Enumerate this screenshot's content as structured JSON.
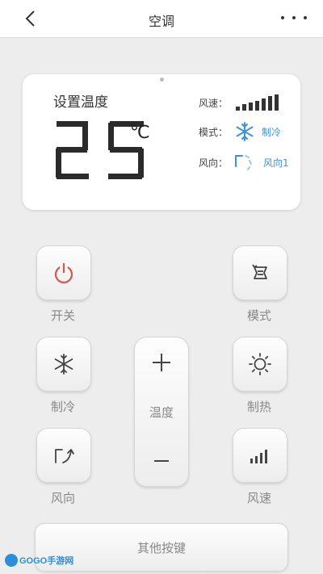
{
  "header": {
    "title": "空调"
  },
  "panel": {
    "set_temp_label": "设置温度",
    "temperature": "25",
    "unit": "℃",
    "wind_speed_label": "风速：",
    "mode_label": "模式：",
    "mode_value": "制冷",
    "wind_dir_label": "风向：",
    "wind_dir_value": "风向1"
  },
  "controls": {
    "power": "开关",
    "mode": "模式",
    "cool": "制冷",
    "heat": "制热",
    "temperature": "温度",
    "wind_dir": "风向",
    "wind_speed": "风速",
    "other_keys": "其他按键"
  },
  "watermark": {
    "text": "GOGO手游网"
  },
  "colors": {
    "accent_blue": "#3c93d6",
    "power_red": "#d9534f"
  },
  "icons": [
    "back-icon",
    "more-icon",
    "wind-speed-bars-icon",
    "snowflake-icon",
    "wind-direction-icon",
    "power-icon",
    "mode-icon",
    "heat-sun-icon",
    "plus-icon",
    "minus-icon"
  ]
}
